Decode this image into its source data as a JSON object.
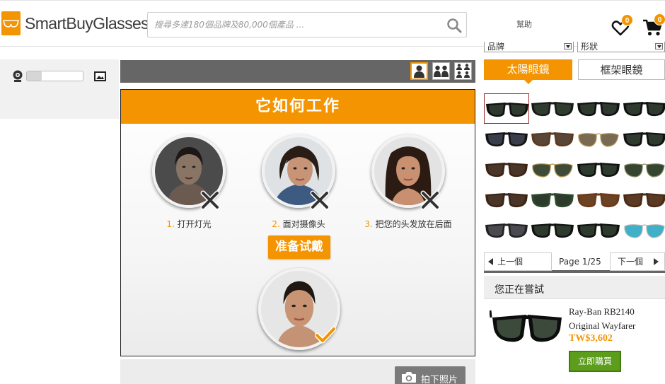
{
  "header": {
    "logo_text": "SmartBuyGlasses",
    "search_placeholder": "搜尋多達180個品牌及80,000個產品 ...",
    "help_label": "幫助",
    "wishlist_count": "0",
    "cart_count": "0"
  },
  "center": {
    "title": "它如何工作",
    "steps": [
      {
        "num": "1.",
        "label": "打开灯光"
      },
      {
        "num": "2.",
        "label": "面对摄像头"
      },
      {
        "num": "3.",
        "label": "把您的头发放在后面"
      }
    ],
    "ready_button": "准备试戴",
    "photo_button": "拍下照片"
  },
  "filters": {
    "brand_label": "品牌",
    "shape_label": "形狀"
  },
  "tabs": {
    "sunglasses": "太陽眼鏡",
    "frames": "框架眼鏡"
  },
  "pager": {
    "prev": "上一個",
    "page": "Page 1/25",
    "next": "下一個"
  },
  "trying": {
    "title": "您正在嘗試",
    "product_name": "Ray-Ban RB2140 Original Wayfarer",
    "price": "TW$3,602",
    "buy_button": "立即購買"
  },
  "colors": {
    "accent": "#f39400",
    "buy": "#5c9d1b"
  }
}
